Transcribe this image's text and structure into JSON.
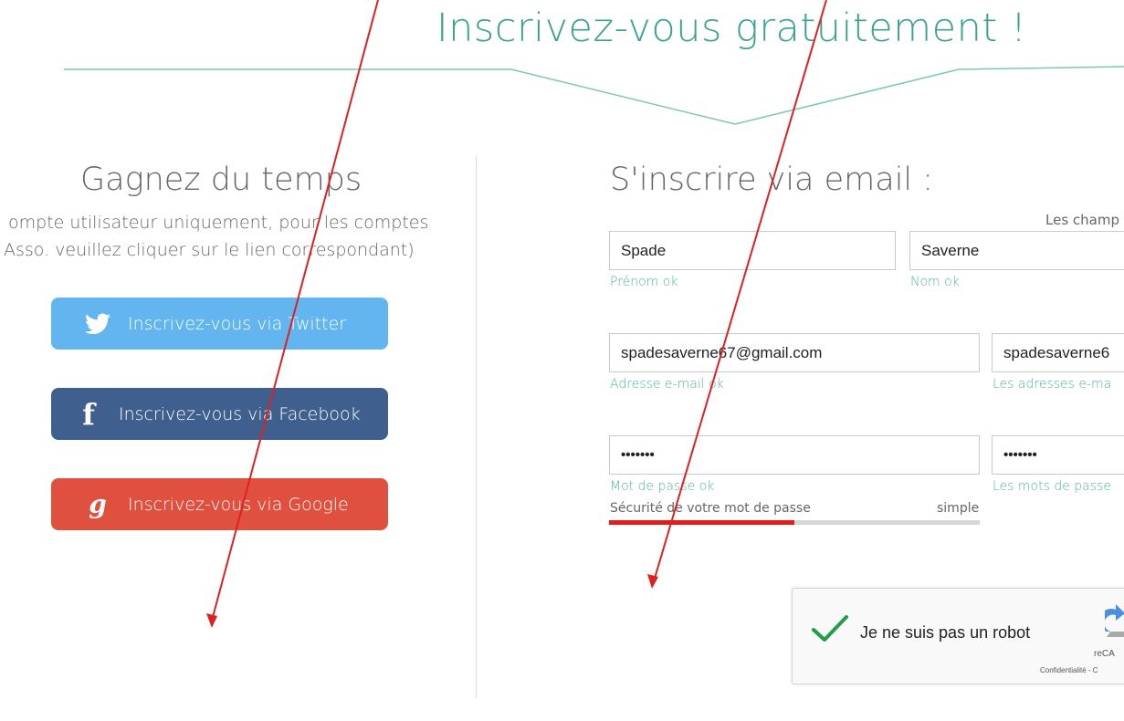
{
  "header": {
    "title": "Inscrivez-vous gratuitement !"
  },
  "left": {
    "title": "Gagnez du temps",
    "subtitle_line1": "ompte utilisateur uniquement, pour les comptes",
    "subtitle_line2": "Asso. veuillez cliquer sur le lien correspondant)",
    "buttons": {
      "twitter": "Inscrivez-vous via Twitter",
      "facebook": "Inscrivez-vous via Facebook",
      "google": "Inscrivez-vous via Google"
    }
  },
  "right": {
    "title": "S'inscrire via email :",
    "required_note": "Les champ",
    "fields": {
      "first_name": {
        "value": "Spade",
        "hint": "Prénom ok"
      },
      "last_name": {
        "value": "Saverne",
        "hint": "Nom ok"
      },
      "email": {
        "value": "spadesaverne67@gmail.com",
        "hint": "Adresse e-mail ok"
      },
      "email_confirm": {
        "value": "spadesaverne6",
        "hint": "Les adresses e-ma"
      },
      "password": {
        "value": "•••••••",
        "hint": "Mot de passe ok"
      },
      "password_confirm": {
        "value": "•••••••",
        "hint": "Les mots de passe"
      }
    },
    "password_strength": {
      "label": "Sécurité de votre mot de passe",
      "value_text": "simple",
      "level": 0.5
    }
  },
  "captcha": {
    "label": "Je ne suis pas un robot",
    "brand": "reCA",
    "links": "Confidentialité - C"
  },
  "colors": {
    "accent": "#3aa390",
    "twitter": "#62b5ef",
    "facebook": "#3f5f8f",
    "google": "#e0503e",
    "strength": "#e21b1b",
    "annotation": "#e02020"
  }
}
